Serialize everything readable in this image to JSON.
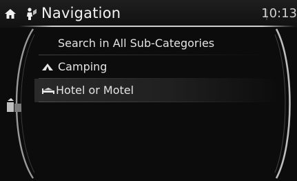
{
  "header": {
    "title": "Navigation",
    "clock": "10:13",
    "home_icon": "home-icon",
    "nav_icon": "navigation-person-icon"
  },
  "list": {
    "items": [
      {
        "label": "Search in All Sub-Categories",
        "icon": ""
      },
      {
        "label": "Camping",
        "icon": "tent-icon"
      },
      {
        "label": "Hotel or Motel",
        "icon": "bed-icon",
        "selected": true
      }
    ]
  },
  "side": {
    "map_icon": "map-view-icon"
  },
  "colors": {
    "background": "#0c0c0c",
    "text": "#e4e4e4",
    "header_line": "#cfcfcf"
  }
}
